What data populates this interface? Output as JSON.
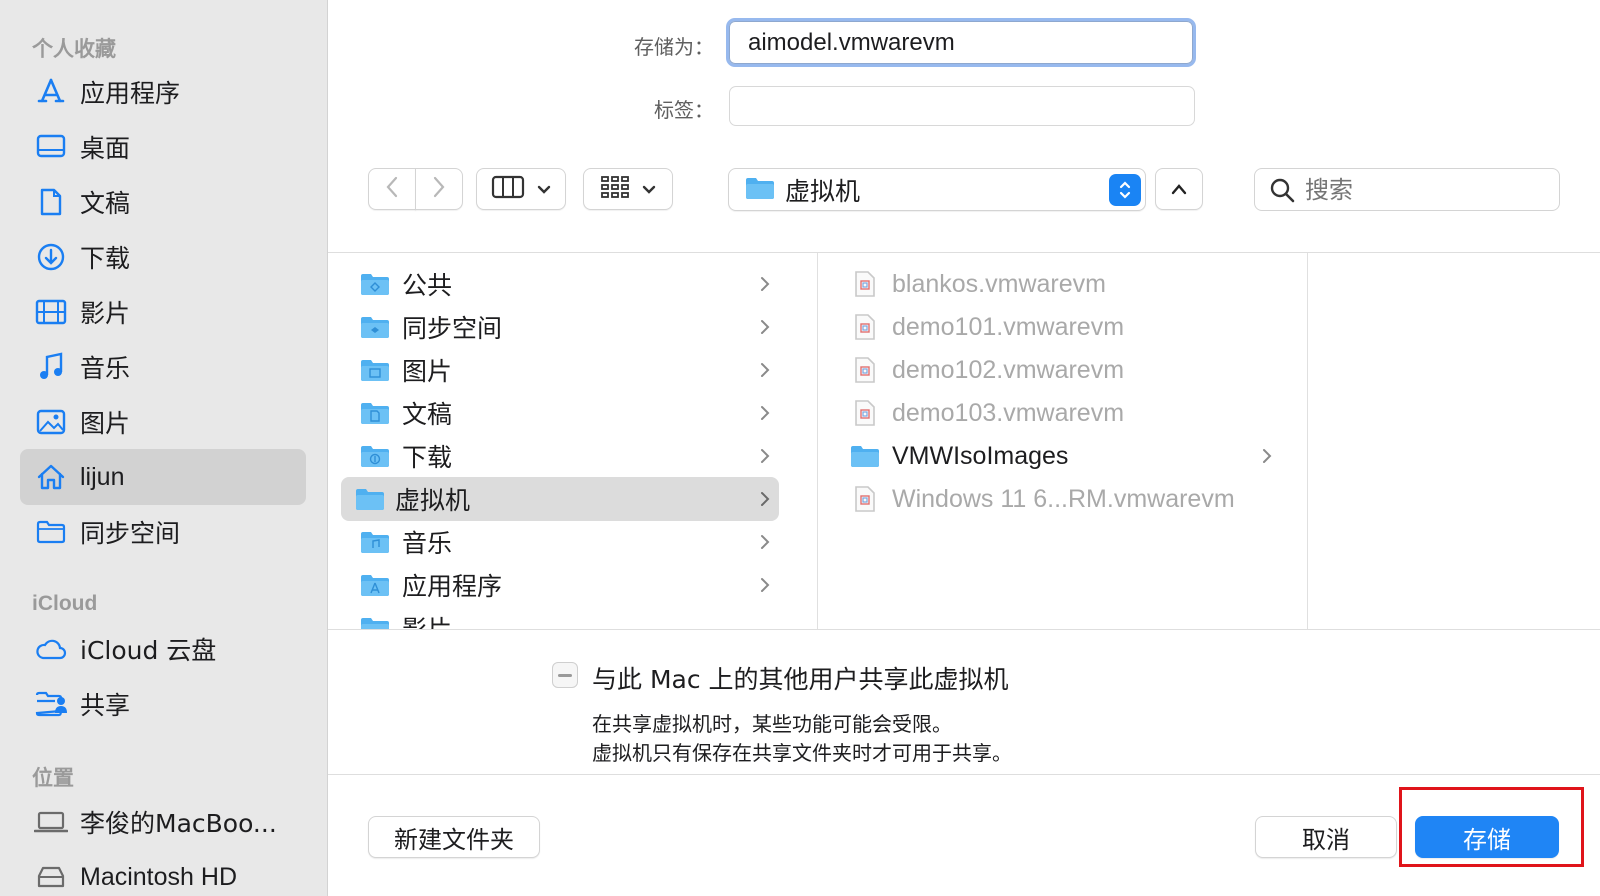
{
  "sidebar": {
    "sections": {
      "favorites": "个人收藏",
      "icloud": "iCloud",
      "locations": "位置"
    },
    "favorites": [
      {
        "label": "应用程序",
        "icon": "applications-icon"
      },
      {
        "label": "桌面",
        "icon": "desktop-icon"
      },
      {
        "label": "文稿",
        "icon": "document-icon"
      },
      {
        "label": "下载",
        "icon": "download-icon"
      },
      {
        "label": "影片",
        "icon": "film-icon"
      },
      {
        "label": "音乐",
        "icon": "music-note-icon"
      },
      {
        "label": "图片",
        "icon": "photo-icon"
      },
      {
        "label": "lijun",
        "icon": "home-icon",
        "selected": true
      },
      {
        "label": "同步空间",
        "icon": "folder-icon"
      }
    ],
    "icloud": [
      {
        "label": "iCloud 云盘",
        "icon": "cloud-icon"
      },
      {
        "label": "共享",
        "icon": "shared-folder-icon"
      }
    ],
    "locations": [
      {
        "label": "李俊的MacBoo...",
        "icon": "laptop-icon"
      },
      {
        "label": "Macintosh HD",
        "icon": "disk-icon"
      }
    ]
  },
  "form": {
    "save_as_label": "存储为：",
    "save_as_value": "aimodel.vmwarevm",
    "tags_label": "标签：",
    "tags_value": ""
  },
  "toolbar": {
    "current_folder": "虚拟机",
    "search_placeholder": "搜索"
  },
  "browser": {
    "column1": [
      {
        "label": "公共",
        "icon": "public-folder-icon"
      },
      {
        "label": "同步空间",
        "icon": "sync-folder-icon"
      },
      {
        "label": "图片",
        "icon": "pictures-folder-icon"
      },
      {
        "label": "文稿",
        "icon": "documents-folder-icon"
      },
      {
        "label": "下载",
        "icon": "downloads-folder-icon"
      },
      {
        "label": "虚拟机",
        "icon": "folder-icon",
        "selected": true
      },
      {
        "label": "音乐",
        "icon": "music-folder-icon"
      },
      {
        "label": "应用程序",
        "icon": "applications-folder-icon"
      },
      {
        "label": "影片",
        "icon": "movies-folder-icon"
      }
    ],
    "column2": [
      {
        "label": "blankos.vmwarevm",
        "icon": "vmware-file-icon",
        "dimmed": true
      },
      {
        "label": "demo101.vmwarevm",
        "icon": "vmware-file-icon",
        "dimmed": true
      },
      {
        "label": "demo102.vmwarevm",
        "icon": "vmware-file-icon",
        "dimmed": true
      },
      {
        "label": "demo103.vmwarevm",
        "icon": "vmware-file-icon",
        "dimmed": true
      },
      {
        "label": "VMWIsoImages",
        "icon": "folder-icon",
        "dimmed": false
      },
      {
        "label": "Windows 11 6...RM.vmwarevm",
        "icon": "vmware-file-icon",
        "dimmed": true
      }
    ]
  },
  "share_option": {
    "label": "与此 Mac 上的其他用户共享此虚拟机",
    "note_line1": "在共享虚拟机时，某些功能可能会受限。",
    "note_line2": "虚拟机只有保存在共享文件夹时才可用于共享。",
    "state": "mixed"
  },
  "buttons": {
    "new_folder": "新建文件夹",
    "cancel": "取消",
    "save": "存储"
  },
  "colors": {
    "accent": "#1f85f5",
    "highlight": "#e0141a",
    "sidebar_bg": "#e8e8e8"
  }
}
